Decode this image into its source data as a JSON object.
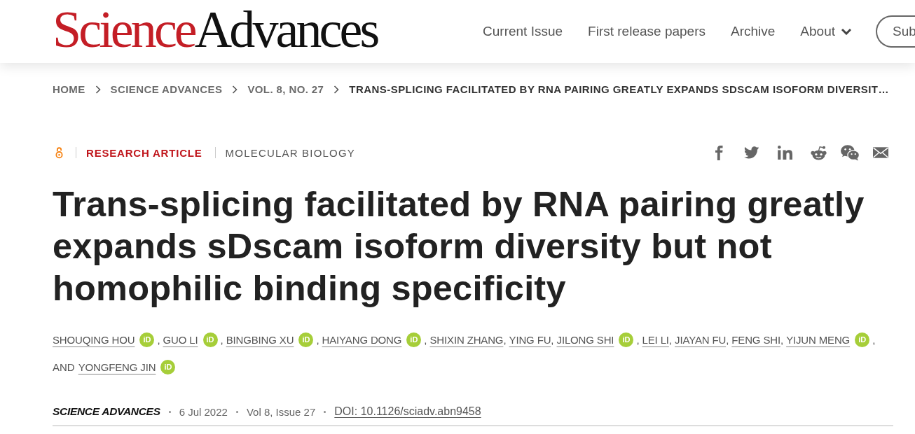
{
  "header": {
    "logo": {
      "first_word": "Science",
      "second_word": "Advances"
    },
    "nav": [
      {
        "label": "Current Issue",
        "kind": "link"
      },
      {
        "label": "First release papers",
        "kind": "link"
      },
      {
        "label": "Archive",
        "kind": "link"
      },
      {
        "label": "About",
        "kind": "dropdown"
      }
    ],
    "subscribe_button": "Sub"
  },
  "breadcrumb": [
    {
      "label": "HOME",
      "current": false
    },
    {
      "label": "SCIENCE ADVANCES",
      "current": false
    },
    {
      "label": "VOL. 8, NO. 27",
      "current": false
    },
    {
      "label": "TRANS-SPLICING FACILITATED BY RNA PAIRING GREATLY EXPANDS SDSCAM ISOFORM DIVERSIT…",
      "current": true
    }
  ],
  "article": {
    "open_access": true,
    "type": "RESEARCH ARTICLE",
    "subject": "MOLECULAR BIOLOGY",
    "share": [
      {
        "kind": "facebook"
      },
      {
        "kind": "twitter"
      },
      {
        "kind": "linkedin"
      },
      {
        "kind": "reddit"
      },
      {
        "kind": "wechat"
      },
      {
        "kind": "email"
      }
    ],
    "title": "Trans-splicing facilitated by RNA pairing greatly expands sDscam isoform diversity but not homophilic binding specificity",
    "authors": [
      {
        "name": "SHOUQING HOU",
        "orcid": "iD",
        "after": ","
      },
      {
        "name": "GUO LI",
        "orcid": "iD",
        "after": ","
      },
      {
        "name": "BINGBING XU",
        "orcid": "iD",
        "after": ","
      },
      {
        "name": "HAIYANG DONG",
        "orcid": "iD",
        "after": ","
      },
      {
        "name": "SHIXIN ZHANG",
        "after": ","
      },
      {
        "name": "YING FU",
        "after": ","
      },
      {
        "name": "JILONG SHI",
        "orcid": "iD",
        "after": ","
      },
      {
        "name": "LEI LI",
        "after": ","
      },
      {
        "name": "JIAYAN FU",
        "after": ","
      },
      {
        "name": "FENG SHI",
        "after": ","
      },
      {
        "name": "YIJUN MENG",
        "orcid": "iD",
        "after": ","
      },
      {
        "before": "AND",
        "name": "YONGFENG JIN",
        "orcid": "iD"
      }
    ],
    "meta": [
      {
        "text": "SCIENCE ADVANCES",
        "kind": "journal"
      },
      {
        "text": "6 Jul 2022",
        "kind": "date"
      },
      {
        "text": "Vol 8, Issue 27",
        "kind": "issue"
      },
      {
        "text": "DOI: 10.1126/sciadv.abn9458",
        "kind": "doi"
      }
    ]
  }
}
